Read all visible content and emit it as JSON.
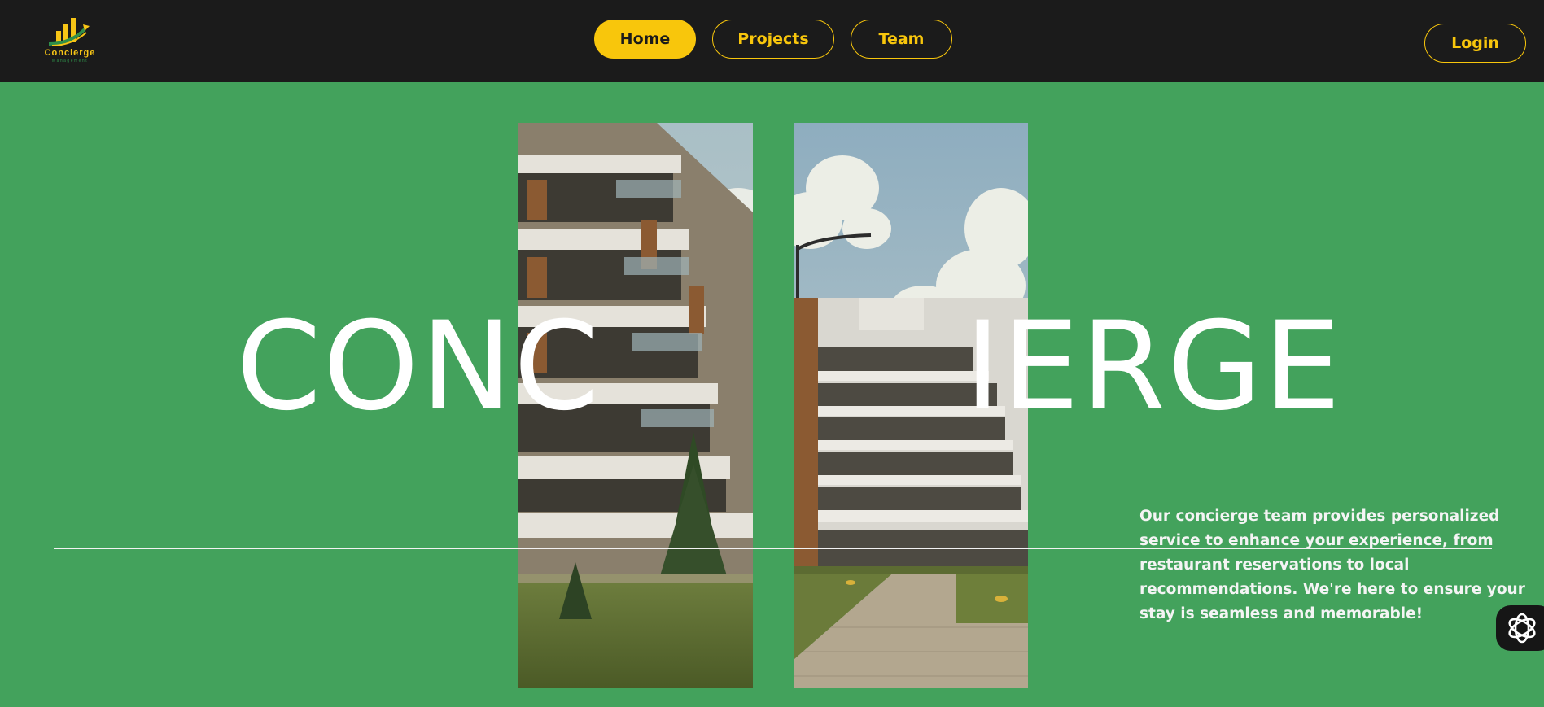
{
  "brand": {
    "name": "Concierge",
    "subtitle": "Management"
  },
  "nav": {
    "home": "Home",
    "projects": "Projects",
    "team": "Team",
    "login": "Login"
  },
  "hero": {
    "word_left": "CONC",
    "word_right": "IERGE",
    "description": "Our concierge team provides personalized service to enhance your experience, from restaurant reservations to local recommendations. We're here to ensure your stay is seamless and memorable!"
  },
  "colors": {
    "background": "#43a25c",
    "header": "#1b1b1b",
    "accent": "#f8c60c"
  },
  "icons": {
    "logo": "bar-chart-arrow-logo",
    "assistant": "openai-knot-icon"
  }
}
